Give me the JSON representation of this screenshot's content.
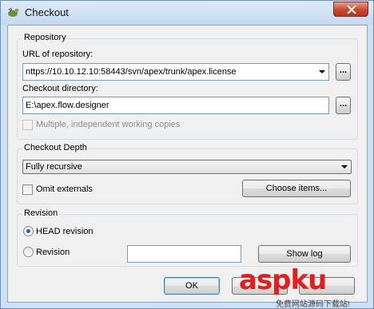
{
  "window": {
    "title": "Checkout"
  },
  "repository": {
    "group_title": "Repository",
    "url_label": "URL of repository:",
    "url_value": "nttps://10.10.12.10:58443/svn/apex/trunk/apex.license",
    "url_browse_label": "...",
    "dir_label": "Checkout directory:",
    "dir_value": "E:\\apex.flow.designer",
    "dir_browse_label": "...",
    "multiple_label": "Multiple, independent working copies"
  },
  "depth": {
    "group_title": "Checkout Depth",
    "selected": "Fully recursive",
    "omit_externals_label": "Omit externals",
    "choose_items_label": "Choose items..."
  },
  "revision": {
    "group_title": "Revision",
    "head_label": "HEAD revision",
    "revision_label": "Revision",
    "revision_value": "",
    "show_log_label": "Show log"
  },
  "buttons": {
    "ok_label": "OK"
  },
  "watermark": {
    "brand": "aspku",
    "tagline": "免费网站源码下载站!"
  }
}
